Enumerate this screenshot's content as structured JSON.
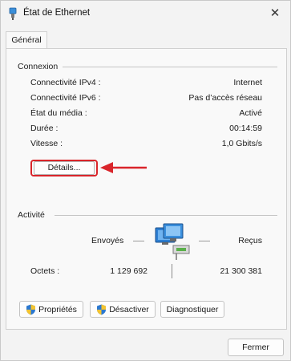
{
  "window": {
    "title": "État de Ethernet",
    "close_glyph": "✕"
  },
  "tabs": [
    {
      "label": "Général"
    }
  ],
  "connection": {
    "header": "Connexion",
    "rows": [
      {
        "label": "Connectivité IPv4 :",
        "value": "Internet"
      },
      {
        "label": "Connectivité IPv6 :",
        "value": "Pas d’accès réseau"
      },
      {
        "label": "État du média :",
        "value": "Activé"
      },
      {
        "label": "Durée :",
        "value": "00:14:59"
      },
      {
        "label": "Vitesse :",
        "value": "1,0 Gbits/s"
      }
    ],
    "details_button": "Détails..."
  },
  "activity": {
    "header": "Activité",
    "sent_label": "Envoyés",
    "received_label": "Reçus",
    "bytes_label": "Octets :",
    "bytes_sent": "1 129 692",
    "bytes_received": "21 300 381"
  },
  "actions": {
    "properties": "Propriétés",
    "disable": "Désactiver",
    "diagnose": "Diagnostiquer"
  },
  "footer": {
    "close_button": "Fermer"
  },
  "colors": {
    "highlight": "#d9252b",
    "accent": "#1a73c9"
  }
}
